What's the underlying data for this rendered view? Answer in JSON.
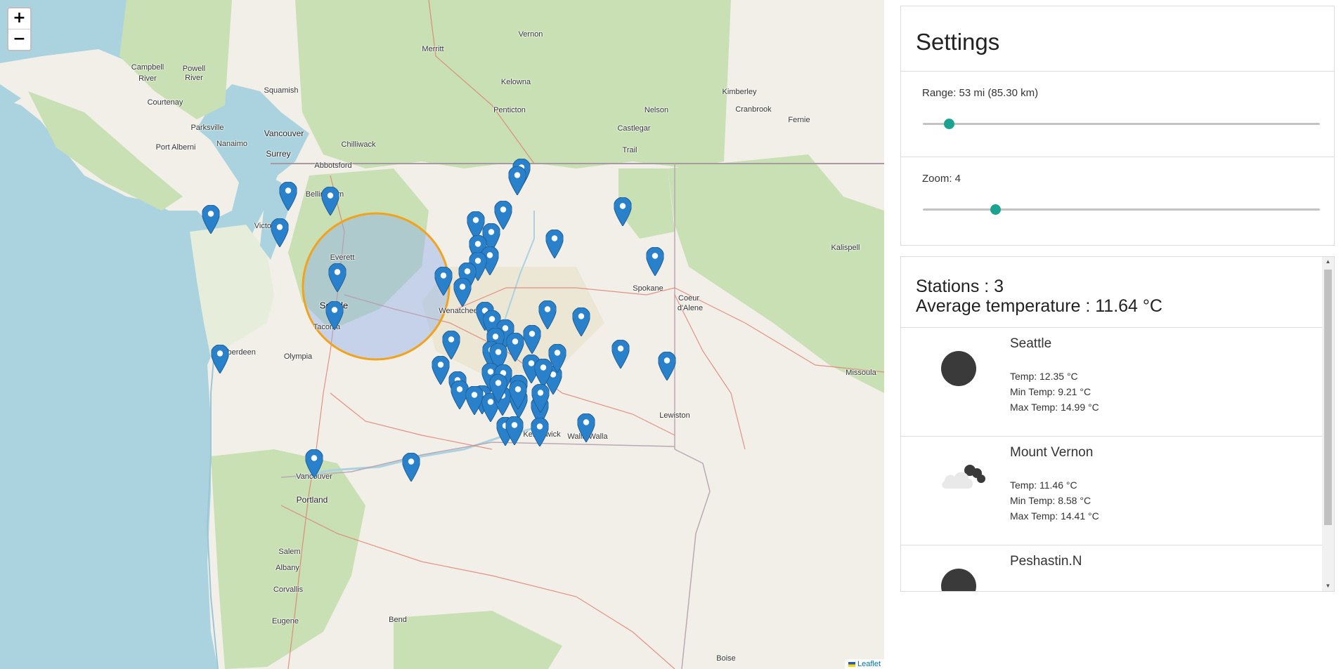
{
  "map": {
    "zoom_in_label": "+",
    "zoom_out_label": "−",
    "attribution": "Leaflet",
    "labels": [
      {
        "text": "Campbell",
        "cls": "map-label"
      },
      {
        "text": "River",
        "cls": "map-label"
      },
      {
        "text": "Powell",
        "cls": "map-label"
      },
      {
        "text": "River",
        "cls": "map-label"
      },
      {
        "text": "Squamish",
        "cls": "map-label"
      },
      {
        "text": "Courtenay",
        "cls": "map-label"
      },
      {
        "text": "Parksville",
        "cls": "map-label"
      },
      {
        "text": "Nanaimo",
        "cls": "map-label"
      },
      {
        "text": "Port Alberni",
        "cls": "map-label"
      },
      {
        "text": "Vancouver",
        "cls": "map-label city"
      },
      {
        "text": "Surrey",
        "cls": "map-label city"
      },
      {
        "text": "Chilliwack",
        "cls": "map-label"
      },
      {
        "text": "Abbotsford",
        "cls": "map-label"
      },
      {
        "text": "Bellingham",
        "cls": "map-label"
      },
      {
        "text": "Victoria",
        "cls": "map-label"
      },
      {
        "text": "Merritt",
        "cls": "map-label"
      },
      {
        "text": "Vernon",
        "cls": "map-label"
      },
      {
        "text": "Kelowna",
        "cls": "map-label"
      },
      {
        "text": "Penticton",
        "cls": "map-label"
      },
      {
        "text": "Nelson",
        "cls": "map-label"
      },
      {
        "text": "Castlegar",
        "cls": "map-label"
      },
      {
        "text": "Trail",
        "cls": "map-label"
      },
      {
        "text": "Kimberley",
        "cls": "map-label"
      },
      {
        "text": "Cranbrook",
        "cls": "map-label"
      },
      {
        "text": "Fernie",
        "cls": "map-label"
      },
      {
        "text": "Kalispell",
        "cls": "map-label"
      },
      {
        "text": "Everett",
        "cls": "map-label"
      },
      {
        "text": "Seattle",
        "cls": "map-label city-lg"
      },
      {
        "text": "Tacoma",
        "cls": "map-label"
      },
      {
        "text": "Olympia",
        "cls": "map-label"
      },
      {
        "text": "Aberdeen",
        "cls": "map-label"
      },
      {
        "text": "Wenatchee",
        "cls": "map-label"
      },
      {
        "text": "Spokane",
        "cls": "map-label"
      },
      {
        "text": "Coeur",
        "cls": "map-label"
      },
      {
        "text": "d'Alene",
        "cls": "map-label"
      },
      {
        "text": "Missoula",
        "cls": "map-label"
      },
      {
        "text": "Lewiston",
        "cls": "map-label"
      },
      {
        "text": "Walla Walla",
        "cls": "map-label"
      },
      {
        "text": "Kennewick",
        "cls": "map-label"
      },
      {
        "text": "Vancouver",
        "cls": "map-label"
      },
      {
        "text": "Portland",
        "cls": "map-label city"
      },
      {
        "text": "Salem",
        "cls": "map-label"
      },
      {
        "text": "Albany",
        "cls": "map-label"
      },
      {
        "text": "Corvallis",
        "cls": "map-label"
      },
      {
        "text": "Eugene",
        "cls": "map-label"
      },
      {
        "text": "Bend",
        "cls": "map-label"
      },
      {
        "text": "Boise",
        "cls": "map-label"
      }
    ]
  },
  "settings": {
    "title": "Settings",
    "range_label": "Range: 53 mi (85.30 km)",
    "range_value_fraction": 0.065,
    "zoom_label": "Zoom: 4",
    "zoom_value_fraction": 0.183
  },
  "stations": {
    "count_label": "Stations : 3",
    "avg_label": "Average temperature : 11.64 °C",
    "items": [
      {
        "name": "Seattle",
        "icon": "night-clear-icon",
        "temp": "Temp: 12.35 °C",
        "min": "Min Temp: 9.21 °C",
        "max": "Max Temp: 14.99 °C"
      },
      {
        "name": "Mount Vernon",
        "icon": "cloudy-night-icon",
        "temp": "Temp: 11.46 °C",
        "min": "Min Temp: 8.58 °C",
        "max": "Max Temp: 14.41 °C"
      },
      {
        "name": "Peshastin.N",
        "icon": "night-clear-icon",
        "temp": "",
        "min": "",
        "max": ""
      }
    ]
  },
  "colors": {
    "accent": "#1aa390",
    "marker": "#2a81cb",
    "range_circle_stroke": "#f2a21b",
    "range_circle_fill": "#8fb0e8"
  }
}
